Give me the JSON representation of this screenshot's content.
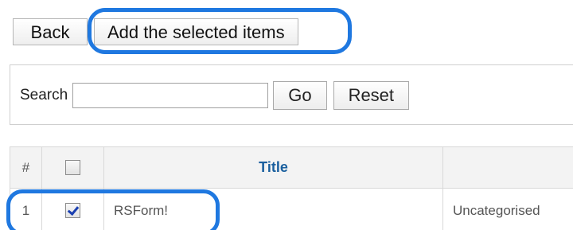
{
  "toolbar": {
    "back_label": "Back",
    "add_selected_label": "Add the selected items"
  },
  "search": {
    "label": "Search",
    "value": "",
    "go_label": "Go",
    "reset_label": "Reset"
  },
  "table": {
    "headers": {
      "num": "#",
      "title": "Title"
    },
    "rows": [
      {
        "num": "1",
        "checked": true,
        "title": "RSForm!",
        "category": "Uncategorised"
      }
    ]
  },
  "colors": {
    "highlight": "#1f78e0",
    "header_link": "#1a5f9e"
  }
}
